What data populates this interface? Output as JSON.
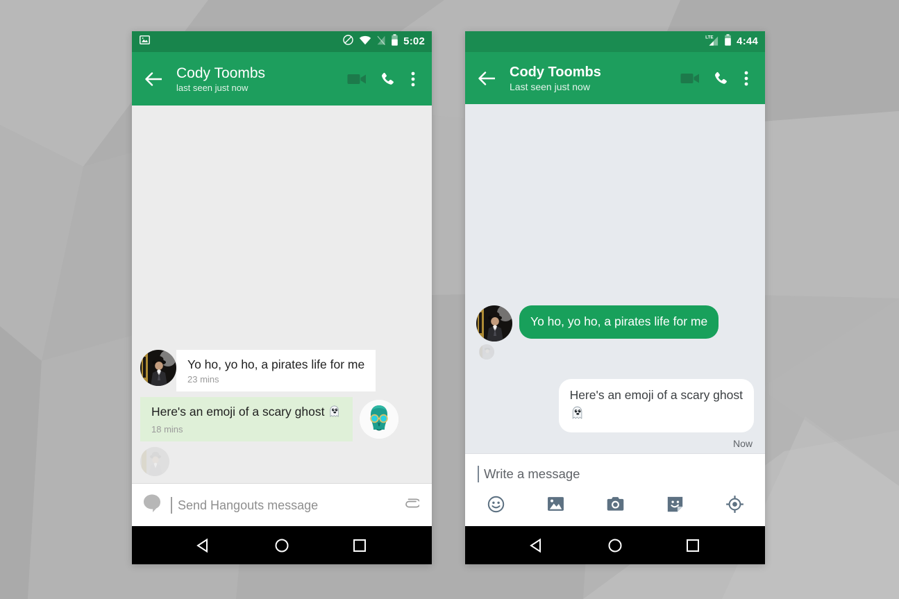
{
  "background": {
    "style": "low-poly-grey",
    "base_color": "#b0b0b0"
  },
  "colors": {
    "status_green": "#18854c",
    "appbar_green": "#1d9e5d",
    "bubble_green_dark": "#18a05b",
    "bubble_green_light": "#dff0d8",
    "bubble_white": "#ffffff",
    "convo_bg_classic": "#ececec",
    "convo_bg_material": "#e7eaee",
    "navbar": "#000000"
  },
  "phones": [
    {
      "id": "classic-hangouts",
      "status_bar": {
        "notification_icon": "image-notification-icon",
        "icons": [
          "do-not-disturb-icon",
          "wifi-icon",
          "signal-off-icon",
          "battery-icon"
        ],
        "time": "5:02"
      },
      "app_bar": {
        "back_icon": "back-arrow-icon",
        "title": "Cody Toombs",
        "subtitle": "last seen just now",
        "actions": [
          "video-call-icon",
          "phone-call-icon",
          "overflow-menu-icon"
        ]
      },
      "messages": [
        {
          "sender": "incoming",
          "avatar": "cody-photo-avatar",
          "text": "Yo ho, yo ho, a pirates life for me",
          "time": "23 mins",
          "bubble": "white"
        },
        {
          "sender": "outgoing",
          "avatar": "teal-face-avatar",
          "text": "Here's an emoji of a scary ghost",
          "emoji": "ghost-emoji",
          "time": "18 mins",
          "bubble": "light-green"
        },
        {
          "sender": "read-receipt",
          "avatar": "cody-photo-avatar-faded"
        }
      ],
      "composer": {
        "avatar_icon": "hangouts-bubble-icon",
        "placeholder": "Send Hangouts message",
        "value": "",
        "actions": [
          "attachment-paperclip-icon"
        ]
      },
      "nav_bar": [
        "back-triangle-icon",
        "home-circle-icon",
        "recents-square-icon"
      ]
    },
    {
      "id": "material-hangouts",
      "status_bar": {
        "notification_icon": "",
        "icons": [
          "lte-signal-icon",
          "battery-icon"
        ],
        "time": "4:44"
      },
      "app_bar": {
        "back_icon": "back-arrow-icon",
        "title": "Cody Toombs",
        "subtitle": "Last seen just now",
        "actions": [
          "video-call-icon",
          "phone-call-icon",
          "overflow-menu-icon"
        ]
      },
      "messages": [
        {
          "sender": "incoming",
          "avatar": "cody-photo-avatar",
          "text": "Yo ho, yo ho, a pirates life for me",
          "bubble": "green"
        },
        {
          "sender": "read-receipt",
          "avatar": "cody-photo-avatar-faded"
        },
        {
          "sender": "outgoing",
          "text": "Here's an emoji of a scary ghost",
          "emoji": "ghost-emoji",
          "time": "Now",
          "bubble": "white"
        }
      ],
      "composer": {
        "placeholder": "Write a message",
        "value": "",
        "actions": [
          "emoji-smiley-icon",
          "gallery-image-icon",
          "camera-icon",
          "sticker-icon",
          "location-icon"
        ]
      },
      "nav_bar": [
        "back-triangle-icon",
        "home-circle-icon",
        "recents-square-icon"
      ]
    }
  ]
}
